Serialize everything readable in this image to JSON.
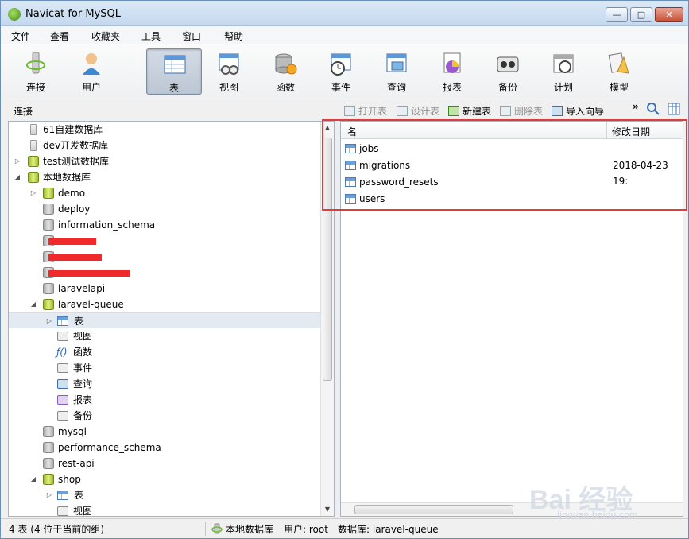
{
  "window": {
    "title": "Navicat for MySQL",
    "min": "—",
    "max": "□",
    "close": "✕"
  },
  "menu": [
    "文件",
    "查看",
    "收藏夹",
    "工具",
    "窗口",
    "帮助"
  ],
  "toolbar": [
    {
      "label": "连接",
      "icon": "connect-icon"
    },
    {
      "label": "用户",
      "icon": "user-icon"
    },
    {
      "label": "表",
      "icon": "table-icon",
      "active": true
    },
    {
      "label": "视图",
      "icon": "view-icon"
    },
    {
      "label": "函数",
      "icon": "function-icon"
    },
    {
      "label": "事件",
      "icon": "event-icon"
    },
    {
      "label": "查询",
      "icon": "query-icon"
    },
    {
      "label": "报表",
      "icon": "report-icon"
    },
    {
      "label": "备份",
      "icon": "backup-icon"
    },
    {
      "label": "计划",
      "icon": "schedule-icon"
    },
    {
      "label": "模型",
      "icon": "model-icon"
    }
  ],
  "subbar": {
    "connection_label": "连接",
    "actions": [
      {
        "label": "打开表",
        "enabled": false
      },
      {
        "label": "设计表",
        "enabled": false
      },
      {
        "label": "新建表",
        "enabled": true
      },
      {
        "label": "删除表",
        "enabled": false
      },
      {
        "label": "导入向导",
        "enabled": true
      }
    ],
    "more": "»"
  },
  "tree": [
    {
      "label": "61自建数据库",
      "type": "conn"
    },
    {
      "label": "dev开发数据库",
      "type": "conn"
    },
    {
      "label": "test测试数据库",
      "type": "conn"
    },
    {
      "label": "本地数据库",
      "type": "conn"
    },
    {
      "label": "demo",
      "type": "dbg"
    },
    {
      "label": "deploy",
      "type": "db"
    },
    {
      "label": "information_schema",
      "type": "db"
    },
    {
      "label": "",
      "type": "db",
      "redacted": true
    },
    {
      "label": "",
      "type": "db",
      "redacted": true
    },
    {
      "label": "",
      "type": "db",
      "redacted": true
    },
    {
      "label": "laravelapi",
      "type": "db"
    },
    {
      "label": "laravel-queue",
      "type": "dbg"
    },
    {
      "label": "表",
      "type": "tbl"
    },
    {
      "label": "视图",
      "type": "obj"
    },
    {
      "label": "函数",
      "type": "obj"
    },
    {
      "label": "事件",
      "type": "obj"
    },
    {
      "label": "查询",
      "type": "obj"
    },
    {
      "label": "报表",
      "type": "obj"
    },
    {
      "label": "备份",
      "type": "obj"
    },
    {
      "label": "mysql",
      "type": "db"
    },
    {
      "label": "performance_schema",
      "type": "db"
    },
    {
      "label": "rest-api",
      "type": "db"
    },
    {
      "label": "shop",
      "type": "dbg"
    },
    {
      "label": "表",
      "type": "tbl"
    },
    {
      "label": "视图",
      "type": "obj"
    }
  ],
  "list": {
    "col_name": "名",
    "col_date": "修改日期",
    "rows": [
      {
        "name": "jobs",
        "date": ""
      },
      {
        "name": "migrations",
        "date": "2018-04-23 19:"
      },
      {
        "name": "password_resets",
        "date": ""
      },
      {
        "name": "users",
        "date": ""
      }
    ]
  },
  "status": {
    "count": "4 表 (4 位于当前的组)",
    "connection": "本地数据库",
    "user": "用户: root",
    "database": "数据库: laravel-queue"
  },
  "watermark": {
    "main": "Bai 经验",
    "sub": "jingyan.baidu.com"
  }
}
